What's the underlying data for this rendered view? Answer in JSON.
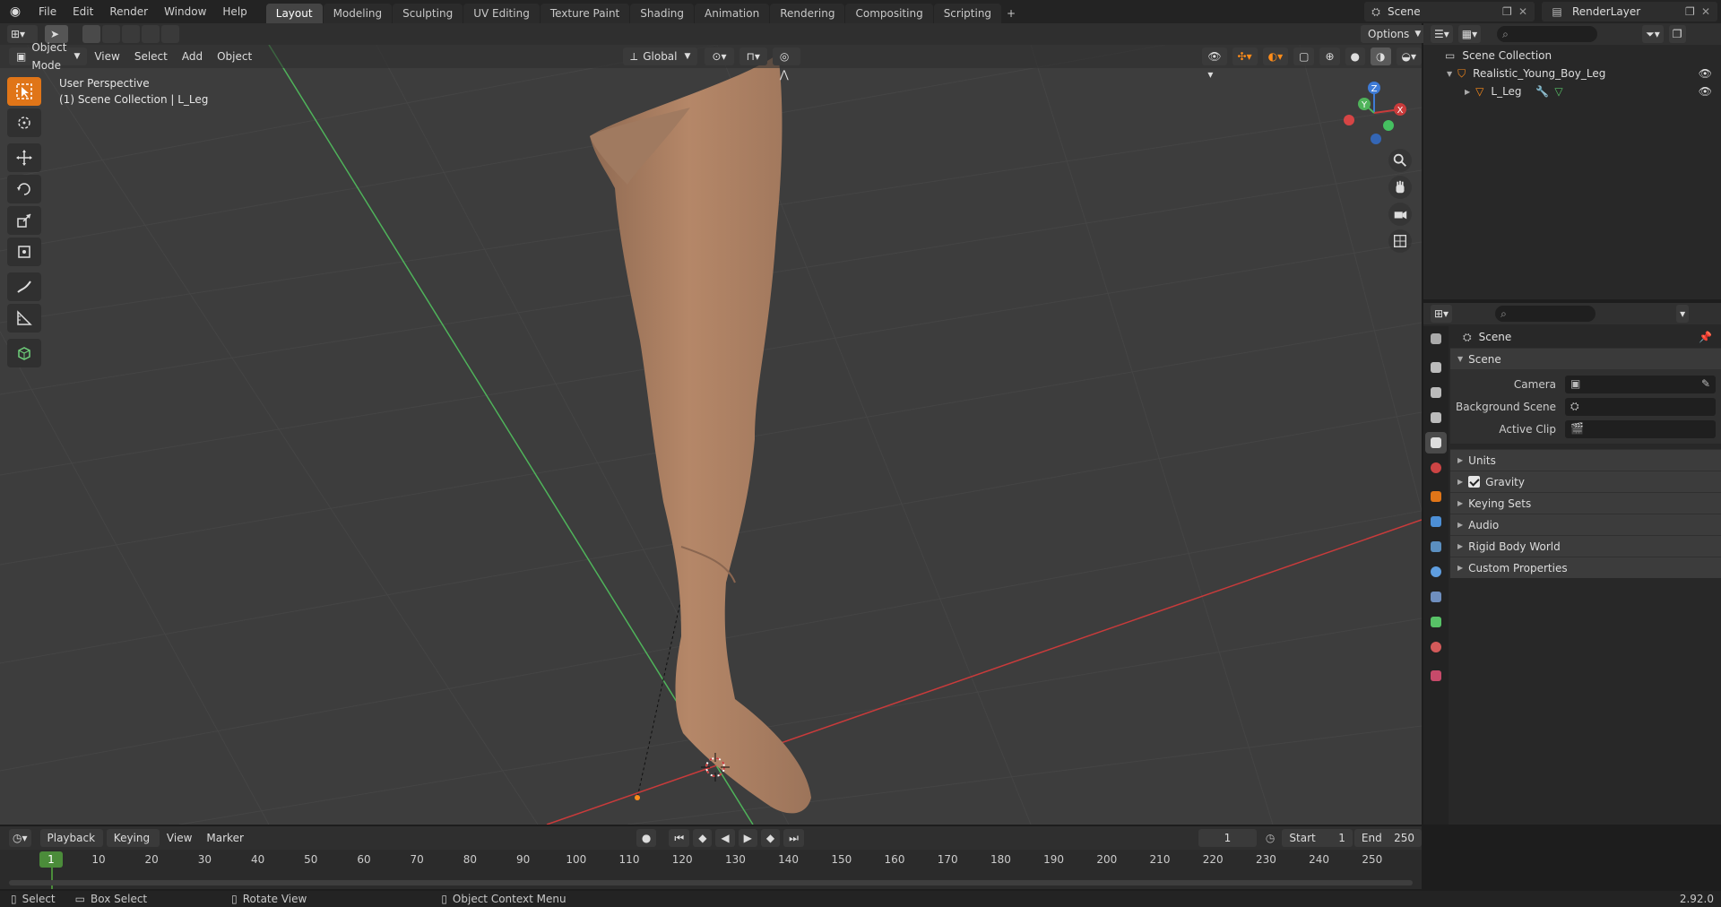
{
  "topbar": {
    "menus": [
      "File",
      "Edit",
      "Render",
      "Window",
      "Help"
    ],
    "workspaces": [
      "Layout",
      "Modeling",
      "Sculpting",
      "UV Editing",
      "Texture Paint",
      "Shading",
      "Animation",
      "Rendering",
      "Compositing",
      "Scripting"
    ],
    "active_workspace": "Layout",
    "add_workspace": "+",
    "scene_name": "Scene",
    "view_layer": "RenderLayer"
  },
  "viewport_header": {
    "mode": "Object Mode",
    "menus": [
      "View",
      "Select",
      "Add",
      "Object"
    ],
    "orientation": "Global",
    "options": "Options"
  },
  "viewport": {
    "perspective": "User Perspective",
    "collection_info": "(1) Scene Collection | L_Leg",
    "axis_labels": {
      "x": "X",
      "y": "Y",
      "z": "Z"
    }
  },
  "outliner": {
    "root": "Scene Collection",
    "collection": "Realistic_Young_Boy_Leg",
    "object": "L_Leg"
  },
  "properties": {
    "header": "Scene",
    "panel": "Scene",
    "fields": [
      {
        "label": "Camera"
      },
      {
        "label": "Background Scene"
      },
      {
        "label": "Active Clip"
      }
    ],
    "subpanels": [
      "Units",
      "Gravity",
      "Keying Sets",
      "Audio",
      "Rigid Body World",
      "Custom Properties"
    ]
  },
  "timeline_header": {
    "menus": [
      "Playback",
      "Keying",
      "View",
      "Marker"
    ],
    "current_frame": "1",
    "start_label": "Start",
    "start": "1",
    "end_label": "End",
    "end": "250"
  },
  "timeline": {
    "current": "1",
    "ticks": [
      "10",
      "20",
      "30",
      "40",
      "50",
      "60",
      "70",
      "80",
      "90",
      "100",
      "110",
      "120",
      "130",
      "140",
      "150",
      "160",
      "170",
      "180",
      "190",
      "200",
      "210",
      "220",
      "230",
      "240",
      "250"
    ]
  },
  "statusbar": {
    "select": "Select",
    "box_select": "Box Select",
    "rotate_view": "Rotate View",
    "context_menu": "Object Context Menu",
    "version": "2.92.0"
  },
  "colors": {
    "accent": "#ff8c19",
    "x_axis": "#c93b3b",
    "y_axis": "#4fb35a",
    "z_axis": "#3e7bd6",
    "skin": "#b58768",
    "frame_marker": "#4b8c3a"
  }
}
